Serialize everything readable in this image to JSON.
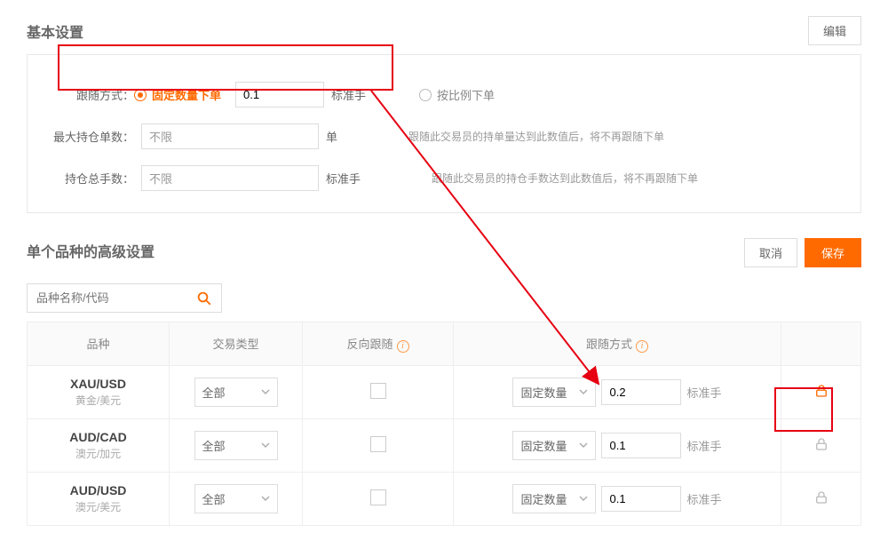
{
  "basic": {
    "title": "基本设置",
    "edit_btn": "编辑",
    "follow_mode_label": "跟随方式：",
    "fixed_qty_label": "固定数量下单",
    "fixed_qty_value": "0.1",
    "std_lot": "标准手",
    "ratio_label": "按比例下单",
    "max_pos_label": "最大持仓单数：",
    "max_pos_value": "不限",
    "max_pos_unit": "单",
    "max_pos_hint": "跟随此交易员的持单量达到此数值后，将不再跟随下单",
    "total_lots_label": "持仓总手数：",
    "total_lots_value": "不限",
    "total_lots_unit": "标准手",
    "total_lots_hint": "跟随此交易员的持仓手数达到此数值后，将不再跟随下单"
  },
  "adv": {
    "title": "单个品种的高级设置",
    "cancel_btn": "取消",
    "save_btn": "保存",
    "search_placeholder": "品种名称/代码",
    "th_symbol": "品种",
    "th_trade_type": "交易类型",
    "th_reverse": "反向跟随",
    "th_follow": "跟随方式",
    "info_glyph": "i",
    "trade_type_all": "全部",
    "follow_type": "固定数量",
    "std_lot": "标准手",
    "rows": [
      {
        "code": "XAU/USD",
        "name": "黄金/美元",
        "qty": "0.2",
        "locked": true
      },
      {
        "code": "AUD/CAD",
        "name": "澳元/加元",
        "qty": "0.1",
        "locked": false
      },
      {
        "code": "AUD/USD",
        "name": "澳元/美元",
        "qty": "0.1",
        "locked": false
      }
    ]
  }
}
